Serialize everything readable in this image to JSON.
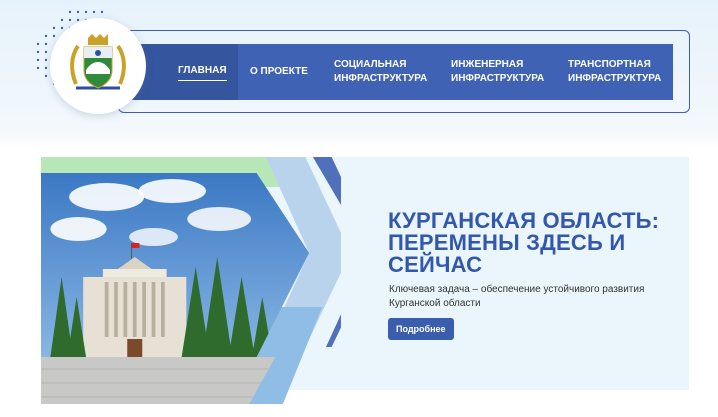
{
  "header": {
    "logo_icon": "coat-of-arms-icon",
    "nav": [
      {
        "label": "ГЛАВНАЯ",
        "active": true
      },
      {
        "label": "О ПРОЕКТЕ"
      },
      {
        "label": "СОЦИАЛЬНАЯ ИНФРАСТРУКТУРА"
      },
      {
        "label": "ИНЖЕНЕРНАЯ ИНФРАСТРУКТУРА"
      },
      {
        "label": "ТРАНСПОРТНАЯ ИНФРАСТРУКТУРА"
      }
    ]
  },
  "hero": {
    "title": "КУРГАНСКАЯ ОБЛАСТЬ: ПЕРЕМЕНЫ ЗДЕСЬ И СЕЙЧАС",
    "text": "Ключевая задача  – обеспечение устойчивого развития Курганской области",
    "button": "Подробнее"
  },
  "colors": {
    "brand": "#3f62b4",
    "title": "#3357ad",
    "hero_bg": "#eaf6fb",
    "accent_green": "#b6e6b4",
    "accent_blue": "#9ec4e6"
  }
}
